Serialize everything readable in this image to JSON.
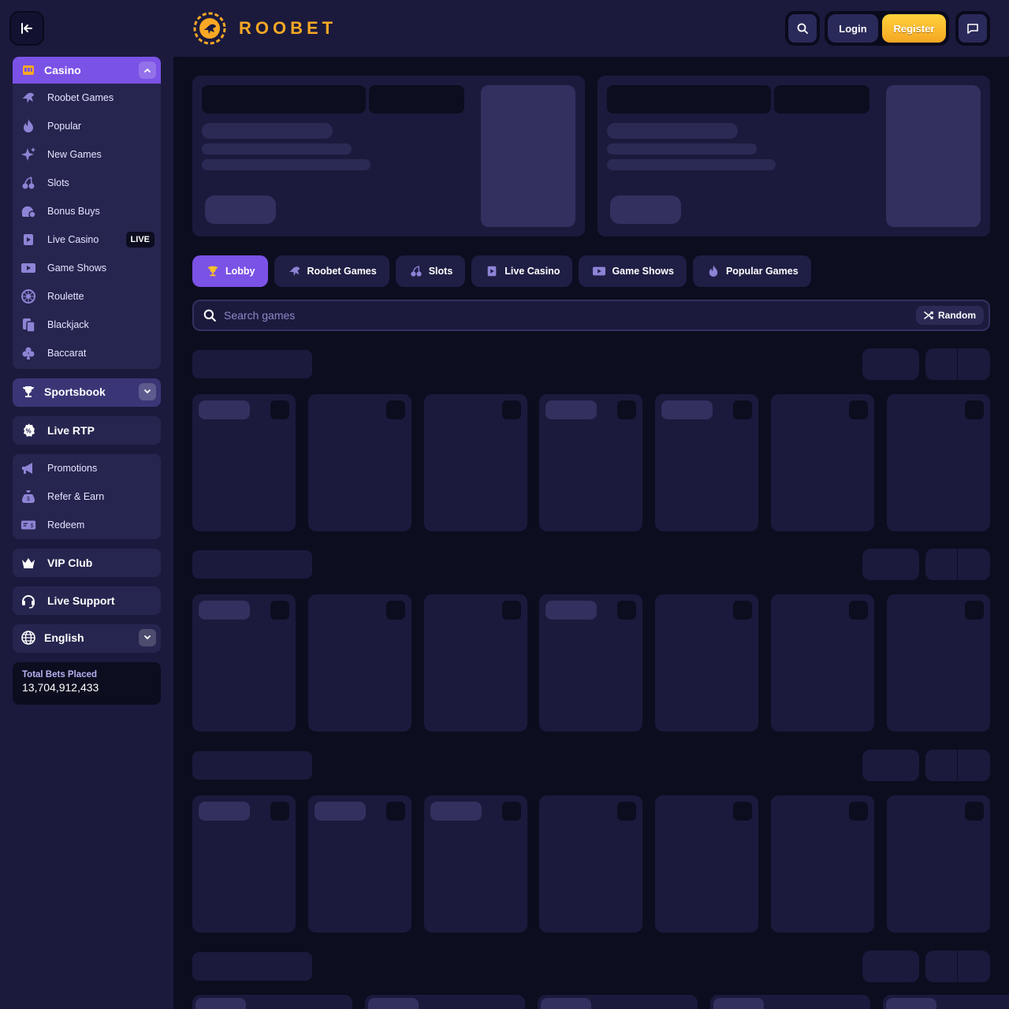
{
  "brand": {
    "name": "ROOBET",
    "accent": "#f7a824",
    "purple": "#7b52e6"
  },
  "header": {
    "collapse_icon": "collapse-left-icon",
    "search_icon": "search-icon",
    "login": "Login",
    "register": "Register",
    "chat_icon": "chat-icon"
  },
  "sidebar": {
    "casino": {
      "label": "Casino",
      "items": [
        {
          "label": "Roobet Games",
          "icon": "kangaroo-icon"
        },
        {
          "label": "Popular",
          "icon": "flame-icon"
        },
        {
          "label": "New Games",
          "icon": "sparkle-icon"
        },
        {
          "label": "Slots",
          "icon": "cherries-icon"
        },
        {
          "label": "Bonus Buys",
          "icon": "bonus-icon"
        },
        {
          "label": "Live Casino",
          "icon": "live-card-icon",
          "badge": "LIVE"
        },
        {
          "label": "Game Shows",
          "icon": "tv-icon"
        },
        {
          "label": "Roulette",
          "icon": "roulette-icon"
        },
        {
          "label": "Blackjack",
          "icon": "cards-icon"
        },
        {
          "label": "Baccarat",
          "icon": "club-icon"
        }
      ]
    },
    "sportsbook": "Sportsbook",
    "live_rtp": "Live RTP",
    "extras": [
      {
        "label": "Promotions",
        "icon": "megaphone-icon"
      },
      {
        "label": "Refer & Earn",
        "icon": "money-bag-icon"
      },
      {
        "label": "Redeem",
        "icon": "voucher-icon"
      }
    ],
    "vip": "VIP Club",
    "support": "Live Support",
    "language": "English",
    "stats": {
      "label": "Total Bets Placed",
      "value": "13,704,912,433"
    }
  },
  "main": {
    "tabs": [
      {
        "label": "Lobby",
        "icon": "trophy-icon",
        "active": true
      },
      {
        "label": "Roobet Games",
        "icon": "kangaroo-icon"
      },
      {
        "label": "Slots",
        "icon": "cherries-icon"
      },
      {
        "label": "Live Casino",
        "icon": "live-card-icon"
      },
      {
        "label": "Game Shows",
        "icon": "tv-icon"
      },
      {
        "label": "Popular Games",
        "icon": "flame-icon"
      }
    ],
    "search": {
      "placeholder": "Search games",
      "random": "Random"
    }
  }
}
